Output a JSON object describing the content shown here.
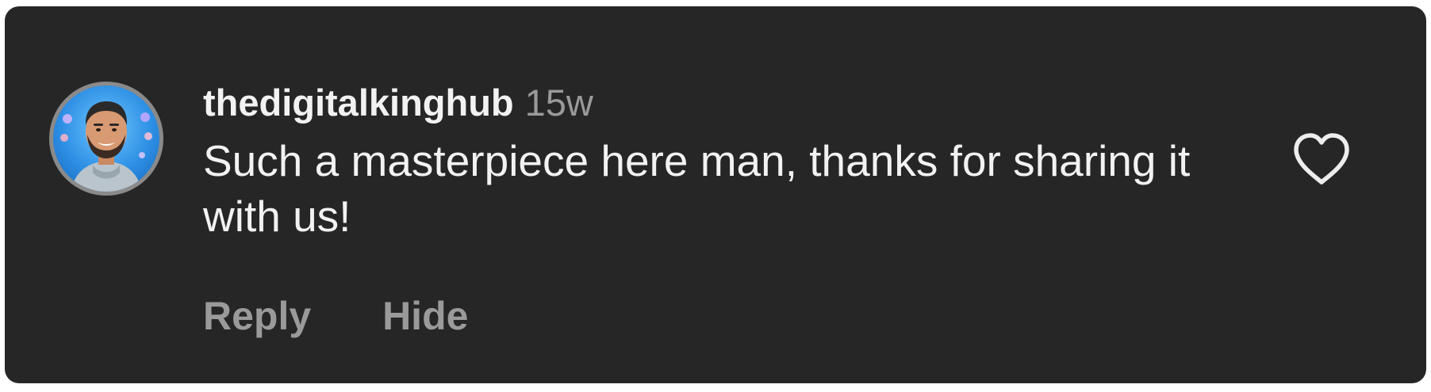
{
  "comment": {
    "username": "thedigitalkinghub",
    "time": "15w",
    "text": "Such a masterpiece here man, thanks for sharing it with us!",
    "actions": {
      "reply_label": "Reply",
      "hide_label": "Hide"
    },
    "icons": {
      "like": "heart-outline-icon",
      "avatar": "profile-avatar"
    }
  },
  "colors": {
    "background": "#262626",
    "primary_text": "#f2f2f2",
    "secondary_text": "#9a9a9a"
  }
}
